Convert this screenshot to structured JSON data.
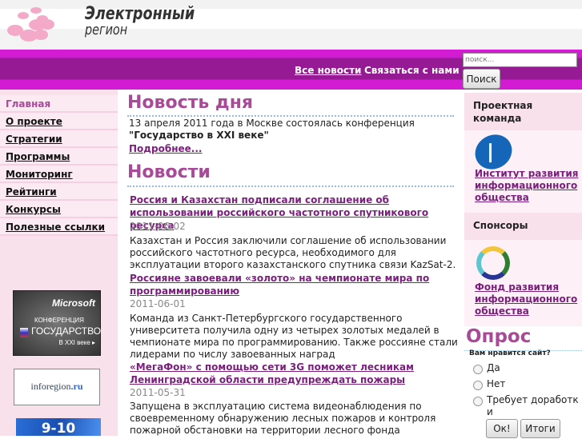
{
  "header": {
    "logo_line1": "Электронный",
    "logo_line2": "регион"
  },
  "topnav": {
    "all_news": "Все новости",
    "contact": "Связаться с нами",
    "search_placeholder": "поиск...",
    "search_button": "Поиск"
  },
  "sidebar": {
    "items": [
      {
        "label": "Главная"
      },
      {
        "label": "О проекте"
      },
      {
        "label": "Стратегии"
      },
      {
        "label": "Программы"
      },
      {
        "label": "Мониторинг"
      },
      {
        "label": "Рейтинги"
      },
      {
        "label": "Конкурсы"
      },
      {
        "label": "Полезные ссылки"
      }
    ],
    "banners": {
      "microsoft": "Microsoft",
      "conf": "КОНФЕРЕНЦИЯ",
      "state": "ГОСУДАРСТВО",
      "century": "В XXI веке ▸",
      "inforegion": "inforegion",
      "ru": ".ru",
      "date": "9-10"
    }
  },
  "main": {
    "news_of_day_title": "Новость дня",
    "news_of_day_text": "13 апреля 2011 года в Москве состоялась конференция",
    "news_of_day_bold": "\"Государство в XXI веке\"",
    "more": "Подробнее...",
    "news_title": "Новости",
    "news": [
      {
        "title": "Россия и Казахстан подписали соглашение об использовании российского частотного спутникового ресурса",
        "date": "2011-06-02",
        "text": "Казахстан и Россия заключили соглашение об использовании российского частотного ресурса, необходимого для эксплуатации второго казахстанского спутника связи KazSat-2."
      },
      {
        "title": "Россияне завоевали «золото» на чемпионате мира по программированию",
        "date": "2011-06-01",
        "text": "Команда из Санкт-Петербургского государственного университета получила одну из четырех золотых медалей в чемпионате мира по программированию. Также россияне стали лидерами по числу завоеванных наград"
      },
      {
        "title": "«МегаФон» с помощью сети 3G поможет лесникам Ленинградской области предупреждать пожары",
        "date": "2011-05-31",
        "text": "Запущена в эксплуатацию система видеонаблюдения по своевременному обнаружению лесных пожаров и контроля пожарной обстановки на территории лесного фонда"
      }
    ]
  },
  "right": {
    "team_title": "Проектная команда",
    "team_link": "Институт развития информационного общества",
    "sponsors_title": "Спонсоры",
    "sponsor_link": "Фонд развития информационного общества",
    "poll": {
      "title": "Опрос",
      "question": "Вам нравится сайт?",
      "options": [
        "Да",
        "Нет",
        "Требует доработки"
      ],
      "ok": "Ок!",
      "results": "Итоги"
    }
  }
}
